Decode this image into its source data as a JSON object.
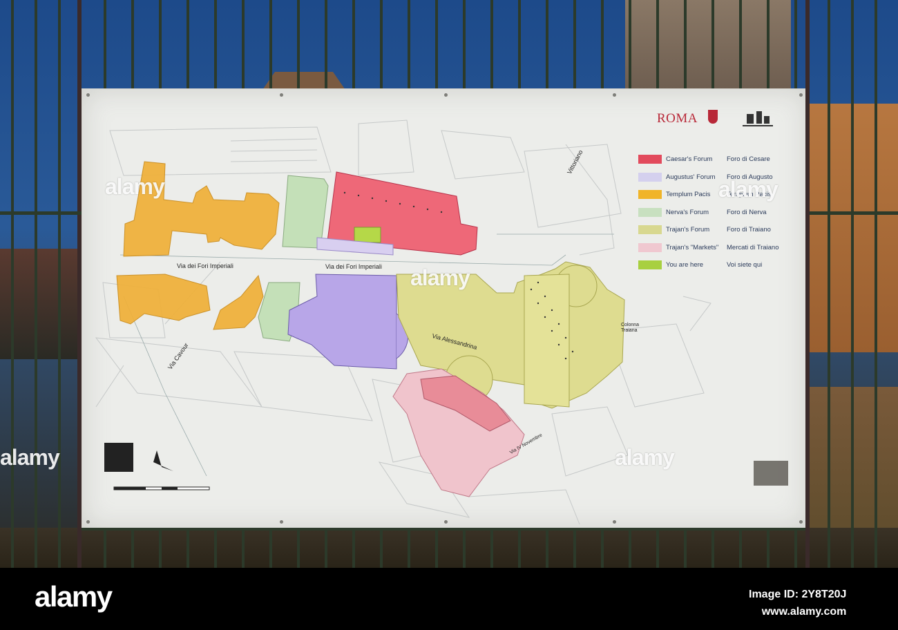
{
  "sign": {
    "brand": "ROMA",
    "legend": [
      {
        "en": "Caesar's Forum",
        "it": "Foro di Cesare",
        "color": "#e24a5c"
      },
      {
        "en": "Augustus' Forum",
        "it": "Foro di Augusto",
        "color": "#d4d0ee"
      },
      {
        "en": "Templum Pacis",
        "it": "Templum Pacis",
        "color": "#f0b428"
      },
      {
        "en": "Nerva's Forum",
        "it": "Foro di Nerva",
        "color": "#c8e0c0"
      },
      {
        "en": "Trajan's Forum",
        "it": "Foro di Traiano",
        "color": "#d8d890"
      },
      {
        "en": "Trajan's \"Markets\"",
        "it": "Mercati di Traiano",
        "color": "#f0c8d0"
      },
      {
        "en": "You are here",
        "it": "Voi siete qui",
        "color": "#a8d040"
      }
    ],
    "streets": {
      "vittoriano": "Vittoriano",
      "fori_left": "Via dei Fori Imperiali",
      "fori_mid": "Via dei Fori Imperiali",
      "alessandrina": "Via Alessandrina",
      "cavour": "Via Cavour",
      "colonna": "Colonna Traiana",
      "novembre": "Via IV Novembre"
    }
  },
  "watermark": "alamy",
  "footer": {
    "logo": "alamy",
    "image_id": "Image ID: 2Y8T20J",
    "site": "www.alamy.com"
  }
}
